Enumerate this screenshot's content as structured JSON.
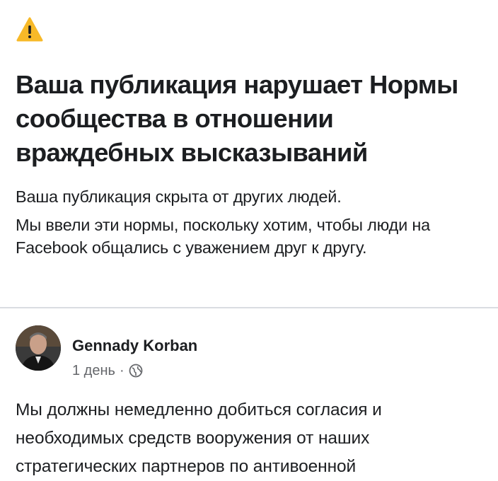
{
  "notice": {
    "icon": "warning-icon",
    "title": "Ваша публикация нарушает Нормы сообщества в отношении враждебных высказываний",
    "line1": "Ваша публикация скрыта от других людей.",
    "line2": "Мы ввели эти нормы, поскольку хотим, чтобы люди на Facebook общались с уважением друг к другу."
  },
  "post": {
    "author": "Gennady Korban",
    "time": "1 день",
    "separator": "·",
    "privacy_icon": "globe-icon",
    "text": "Мы должны немедленно добиться согласия и необходимых средств вооружения от наших стратегических партнеров по антивоенной"
  },
  "colors": {
    "warning": "#f7b928",
    "text": "#1c1e21",
    "secondary": "#65676b",
    "divider": "#dadde1"
  }
}
